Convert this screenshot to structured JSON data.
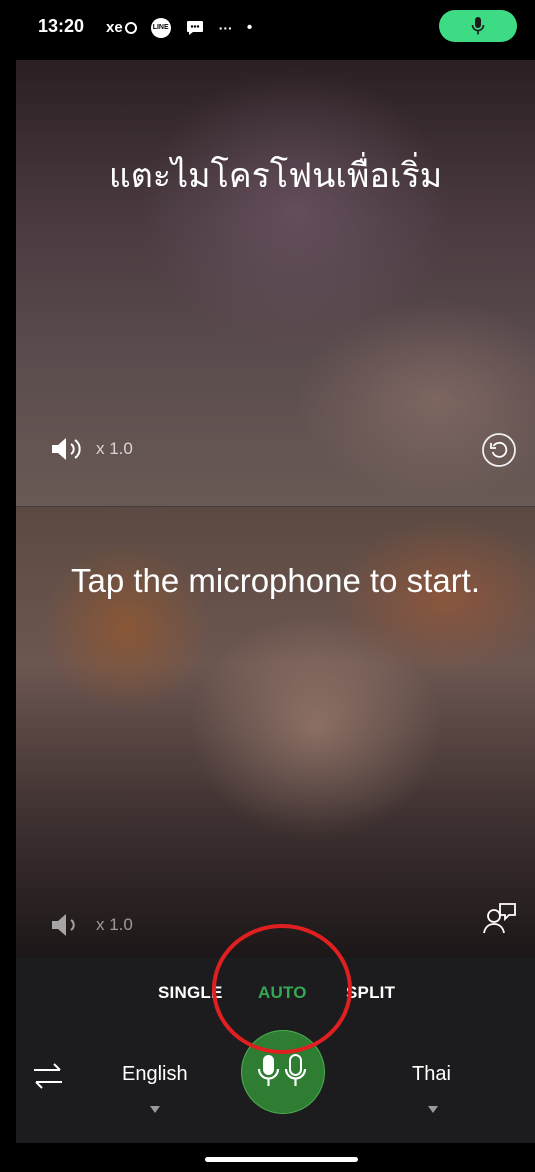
{
  "status_bar": {
    "time": "13:20",
    "icons": [
      "xe-app-icon",
      "line-app-icon",
      "chat-icon",
      "more-icon",
      "dot-icon"
    ],
    "xe_label": "xe",
    "line_label": "LINE",
    "more_label": "···",
    "dot_label": "•",
    "mic_pill_color": "#3ddc84"
  },
  "top_panel": {
    "prompt": "แตะไมโครโฟนเพื่อเริ่ม",
    "speed": "x 1.0"
  },
  "bottom_panel": {
    "prompt": "Tap the microphone to start.",
    "speed": "x 1.0"
  },
  "modes": {
    "single": "SINGLE",
    "auto": "AUTO",
    "split": "SPLIT",
    "active": "AUTO",
    "active_color": "#34a853"
  },
  "languages": {
    "source": "English",
    "target": "Thai"
  },
  "colors": {
    "mic_button": "#2e7d32",
    "annotation_ring": "#e02020"
  }
}
